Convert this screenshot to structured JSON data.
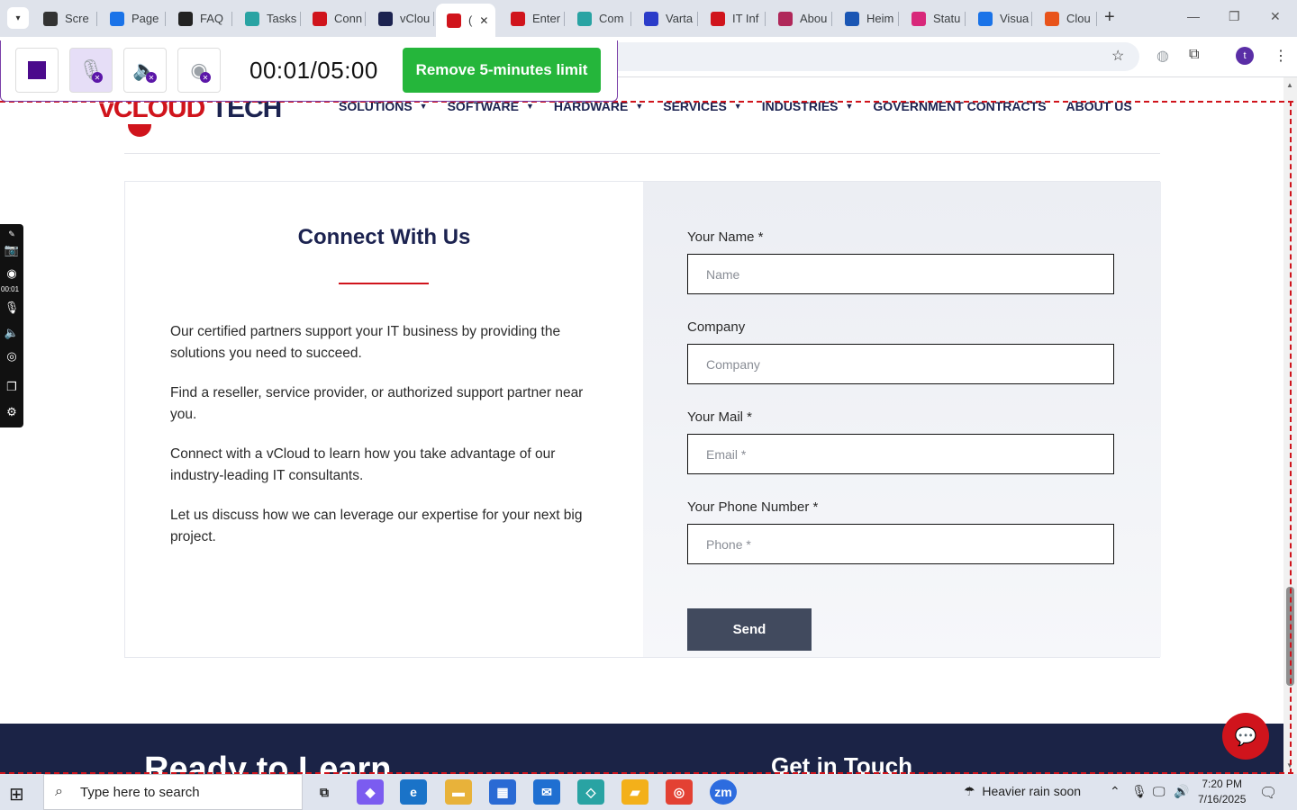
{
  "browser": {
    "tabs": [
      {
        "label": "Scre",
        "favicon_color": "#333333"
      },
      {
        "label": "Page",
        "favicon_color": "#1a73e8"
      },
      {
        "label": "FAQ",
        "favicon_color": "#222222"
      },
      {
        "label": "Tasks",
        "favicon_color": "#29a3a3"
      },
      {
        "label": "Conn",
        "favicon_color": "#d0141c"
      },
      {
        "label": "vClou",
        "favicon_color": "#1c2350"
      },
      {
        "label": "(",
        "favicon_color": "#d0141c"
      },
      {
        "label": "Enter",
        "favicon_color": "#d0141c"
      },
      {
        "label": "Com",
        "favicon_color": "#29a3a3"
      },
      {
        "label": "Varta",
        "favicon_color": "#2b3cc9"
      },
      {
        "label": "IT Inf",
        "favicon_color": "#d0141c"
      },
      {
        "label": "Abou",
        "favicon_color": "#b0285a"
      },
      {
        "label": "Heim",
        "favicon_color": "#1a56b4"
      },
      {
        "label": "Statu",
        "favicon_color": "#d8287a"
      },
      {
        "label": "Visua",
        "favicon_color": "#1a73e8"
      },
      {
        "label": "Clou",
        "favicon_color": "#e8531a"
      }
    ],
    "profile_initial": "t"
  },
  "recorder": {
    "timer": "00:01/05:00",
    "limit_button": "Remove 5-minutes limit",
    "side_time": "00:01"
  },
  "site": {
    "logo": {
      "v": "v",
      "cloud": "CLOUD",
      "tech": " TECH"
    },
    "nav": [
      {
        "label": "SOLUTIONS",
        "dropdown": true
      },
      {
        "label": "SOFTWARE",
        "dropdown": true
      },
      {
        "label": "HARDWARE",
        "dropdown": true
      },
      {
        "label": "SERVICES",
        "dropdown": true
      },
      {
        "label": "INDUSTRIES",
        "dropdown": true
      },
      {
        "label": "GOVERNMENT CONTRACTS",
        "dropdown": false
      },
      {
        "label": "ABOUT US",
        "dropdown": false
      }
    ]
  },
  "contact": {
    "title": "Connect With Us",
    "paragraphs": [
      "Our certified partners support your IT business by providing the solutions you need to succeed.",
      "Find a reseller, service provider, or authorized support partner near you.",
      "Connect with a vCloud to learn how you take advantage of our industry-leading IT consultants.",
      "Let us discuss how we can leverage our expertise for your next big project."
    ],
    "form": {
      "name_label": "Your Name *",
      "name_placeholder": "Name",
      "company_label": "Company",
      "company_placeholder": "Company",
      "mail_label": "Your Mail *",
      "mail_placeholder": "Email *",
      "phone_label": "Your Phone Number *",
      "phone_placeholder": "Phone *",
      "send": "Send"
    }
  },
  "footer": {
    "left_heading": "Ready to Learn",
    "right_heading": "Get in Touch"
  },
  "taskbar": {
    "search_placeholder": "Type here to search",
    "weather": "Heavier rain soon",
    "time": "7:20 PM",
    "date": "7/16/2025"
  },
  "colors": {
    "brand_red": "#d0141c",
    "brand_navy": "#1c2350",
    "recorder_green": "#25b63b",
    "send_button": "#414a5e"
  }
}
